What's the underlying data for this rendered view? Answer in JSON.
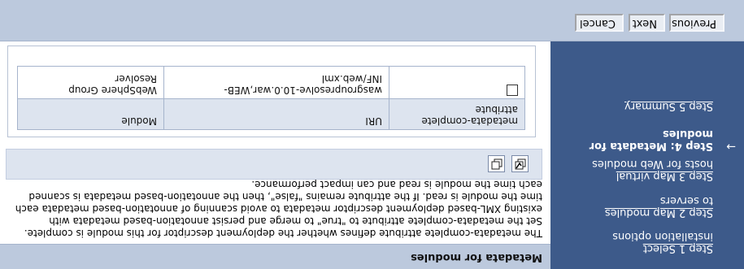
{
  "nav": {
    "steps": [
      {
        "label_line1": "Step 1 Select",
        "label_line2": "installation options"
      },
      {
        "label_line1": "Step 2 Map modules",
        "label_line2": "to servers"
      },
      {
        "label_line1": "Step 3 Map virtual",
        "label_line2": "hosts for Web modules"
      },
      {
        "label_line1": "Step 4: Metadata for",
        "label_line2": "modules",
        "current": true
      },
      {
        "label_line1": "Step 5 Summary",
        "label_line2": ""
      }
    ],
    "current_arrow": "→"
  },
  "page": {
    "title": "Metadata for modules",
    "description": "The metadata-complete attribute defines whether the deployment descriptor for this module is complete. Set the metadata-complete attribute to \"true\" to merge and persist annotation-based metadata with existing XML-based deployment descriptor metadata to avoid scanning of annotation-based metadata each time the module is read. If the attribute remains \"false\", then the annotation-based metadata is scanned each time the module is read and can impact performance.",
    "toolbar_icons": [
      "select-all-icon",
      "deselect-all-icon"
    ]
  },
  "table": {
    "headers": {
      "col1": "metadata-complete",
      "col1_sub": "attribute",
      "col2": "Module",
      "col3": "URI"
    },
    "rows": [
      {
        "checked": false,
        "module": "WebSphere Group Resolver",
        "uri": "wasgroupresolve-10.0.war,WEB-INF/web.xml"
      }
    ]
  },
  "footer": {
    "previous": "Previous",
    "next": "Next",
    "cancel": "Cancel"
  }
}
